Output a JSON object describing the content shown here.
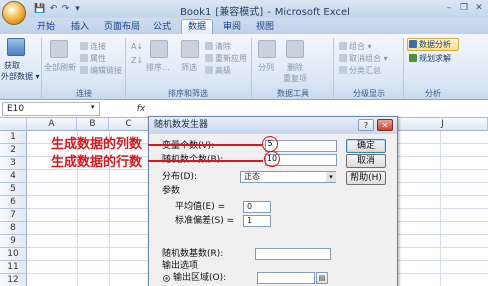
{
  "window": {
    "filename": "Book1",
    "mode": "[兼容模式]",
    "separator": "-",
    "app": "Microsoft Excel"
  },
  "quick_access": {
    "save": "💾",
    "undo": "↶",
    "redo": "↷",
    "more": "▾"
  },
  "window_controls": {
    "minimize": "–",
    "restore": "❐",
    "close": "✕"
  },
  "tabs": [
    "开始",
    "插入",
    "页面布局",
    "公式",
    "数据",
    "审阅",
    "视图"
  ],
  "active_tab": "数据",
  "ribbon": {
    "get_external": {
      "line1": "获取",
      "line2": "外部数据 ▾"
    },
    "connections": {
      "refresh_all": "全部刷新",
      "connections": "连接",
      "properties": "属性",
      "edit_links": "编辑链接",
      "group": "连接"
    },
    "sort_filter": {
      "sort_asc": "A↓",
      "sort_desc": "Z↓",
      "sort": "排序…",
      "filter": "筛选",
      "clear": "清除",
      "reapply": "重新应用",
      "advanced": "高级",
      "group": "排序和筛选"
    },
    "data_tools": {
      "text_to_columns": "分列",
      "remove_duplicates_1": "删除",
      "remove_duplicates_2": "重复项",
      "group": "数据工具"
    },
    "outline": {
      "group_btn": "组合 ▾",
      "ungroup_btn": "取消组合 ▾",
      "subtotal": "分类汇总",
      "group": "分级显示"
    },
    "analysis": {
      "data_analysis": "数据分析",
      "solver": "规划求解",
      "group": "分析"
    }
  },
  "formula_bar": {
    "name_box": "E10",
    "fx": "fx"
  },
  "grid": {
    "columns": [
      "A",
      "B",
      "C",
      "J"
    ],
    "rows": [
      "1",
      "2",
      "3",
      "4",
      "5",
      "6",
      "7",
      "8",
      "9",
      "10",
      "11",
      "12"
    ]
  },
  "annotations": {
    "columns": "生成数据的列数",
    "rows": "生成数据的行数"
  },
  "dialog": {
    "title": "随机数发生器",
    "help": "?",
    "close": "✕",
    "variables_label": "变量个数(V):",
    "variables_value": "5",
    "count_label": "随机数个数(B):",
    "count_value": "10",
    "distribution_label": "分布(D):",
    "distribution_value": "正态",
    "params_label": "参数",
    "mean_label": "平均值(E) =",
    "mean_value": "0",
    "stdev_label": "标准偏差(S) =",
    "stdev_value": "1",
    "seed_label": "随机数基数(R):",
    "output_label": "输出选项",
    "output_range_label": "输出区域(O):",
    "ok": "确定",
    "cancel": "取消",
    "help_btn": "帮助(H)"
  }
}
